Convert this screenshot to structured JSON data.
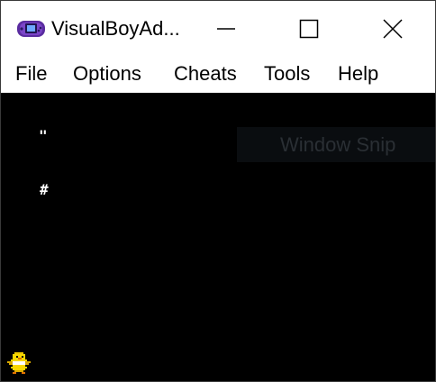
{
  "window": {
    "title": "VisualBoyAd...",
    "icon": "gameboy-advance-icon"
  },
  "controls": {
    "minimize_icon": "minimize-icon",
    "maximize_icon": "maximize-icon",
    "close_icon": "close-icon"
  },
  "menu": {
    "items": [
      {
        "label": "File"
      },
      {
        "label": "Options"
      },
      {
        "label": "Cheats"
      },
      {
        "label": "Tools"
      },
      {
        "label": "Help"
      }
    ]
  },
  "screen": {
    "glyphs": [
      "\"",
      "#"
    ],
    "background": "#000000",
    "sprite": "yellow-bird-sprite"
  },
  "overlay": {
    "label": "Window Snip"
  }
}
